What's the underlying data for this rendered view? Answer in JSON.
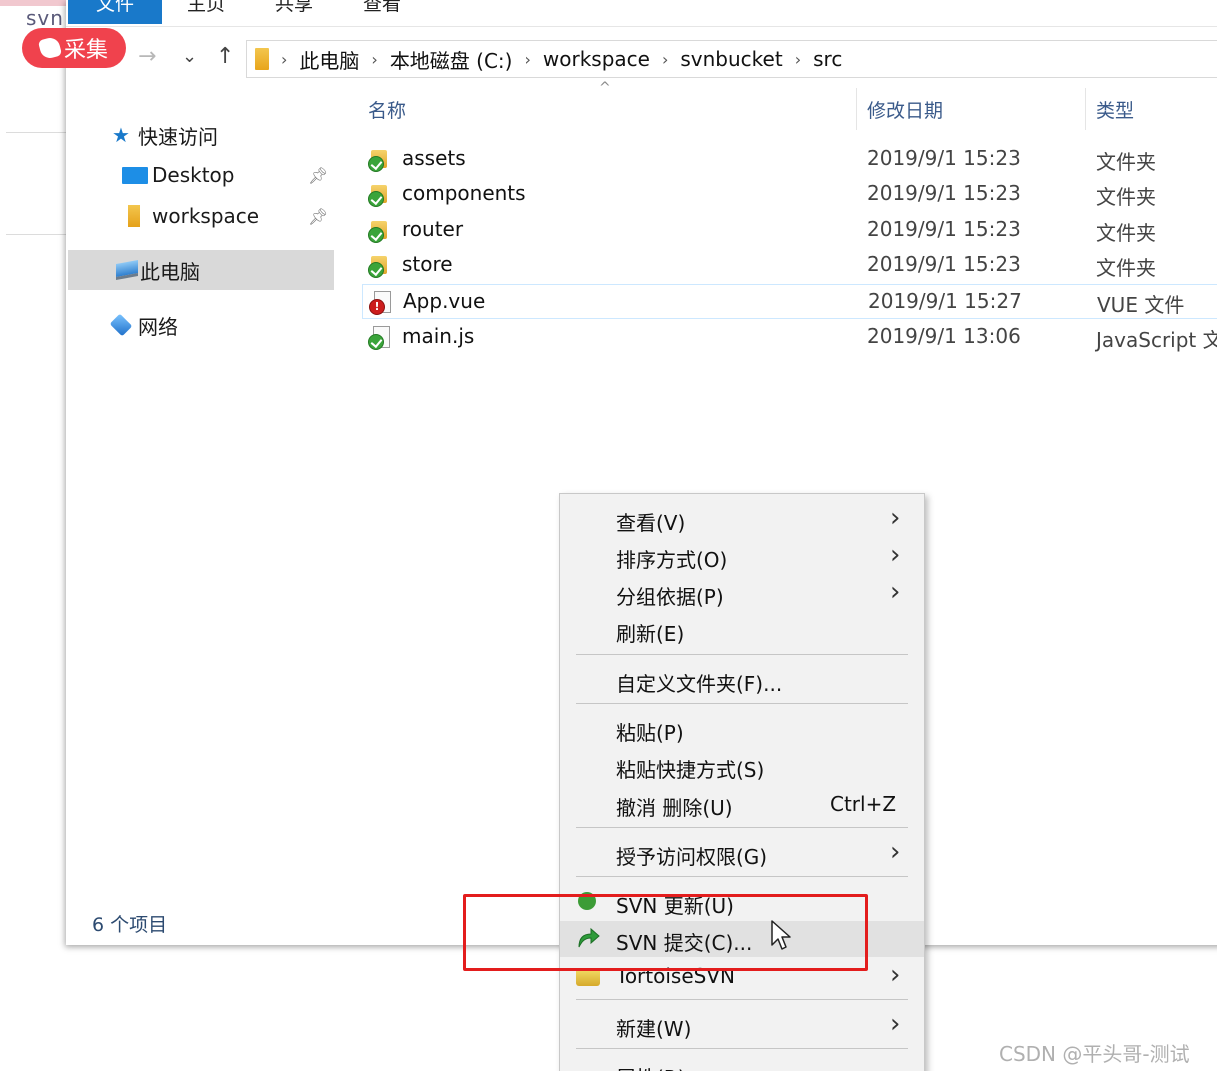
{
  "background": {
    "behind_app_text": "svn"
  },
  "badge": {
    "label": "采集"
  },
  "ribbon": {
    "tabs": [
      "文件",
      "主页",
      "共享",
      "查看"
    ]
  },
  "address_bar": {
    "crumbs": [
      "此电脑",
      "本地磁盘 (C:)",
      "workspace",
      "svnbucket",
      "src"
    ]
  },
  "nav_pane": {
    "quick_access": "快速访问",
    "desktop": "Desktop",
    "workspace": "workspace",
    "this_pc": "此电脑",
    "network": "网络"
  },
  "columns": {
    "name": "名称",
    "modified": "修改日期",
    "type": "类型"
  },
  "files": [
    {
      "name": "assets",
      "date": "2019/9/1 15:23",
      "type": "文件夹",
      "icon": "svn-folder-ok-icon"
    },
    {
      "name": "components",
      "date": "2019/9/1 15:23",
      "type": "文件夹",
      "icon": "svn-folder-ok-icon"
    },
    {
      "name": "router",
      "date": "2019/9/1 15:23",
      "type": "文件夹",
      "icon": "svn-folder-ok-icon"
    },
    {
      "name": "store",
      "date": "2019/9/1 15:23",
      "type": "文件夹",
      "icon": "svn-folder-ok-icon"
    },
    {
      "name": "App.vue",
      "date": "2019/9/1 15:27",
      "type": "VUE 文件",
      "icon": "svn-file-modified-icon"
    },
    {
      "name": "main.js",
      "date": "2019/9/1 13:06",
      "type": "JavaScript 文",
      "icon": "svn-file-ok-icon"
    }
  ],
  "status": {
    "item_count": "6 个项目"
  },
  "context_menu": {
    "view": "查看(V)",
    "sort": "排序方式(O)",
    "group": "分组依据(P)",
    "refresh": "刷新(E)",
    "customize": "自定义文件夹(F)...",
    "paste": "粘贴(P)",
    "paste_shortcut": "粘贴快捷方式(S)",
    "undo": "撤消 删除(U)",
    "undo_shortcut": "Ctrl+Z",
    "grant_access": "授予访问权限(G)",
    "svn_update": "SVN 更新(U)",
    "svn_commit": "SVN 提交(C)...",
    "tortoise": "TortoiseSVN",
    "new": "新建(W)",
    "properties": "属性(R)"
  },
  "watermark": "CSDN @平头哥-测试",
  "colors": {
    "accent": "#1979ca",
    "highlight_box": "#e31d1d",
    "badge": "#f0424d"
  }
}
